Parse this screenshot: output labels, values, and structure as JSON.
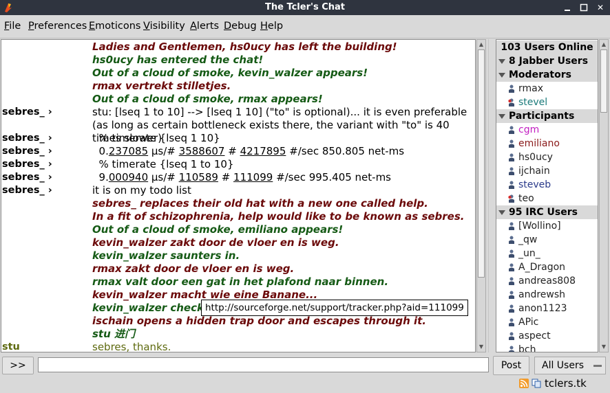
{
  "window": {
    "title": "The Tcler's Chat",
    "close_glyph": "✕"
  },
  "menu": [
    "File",
    "Preferences",
    "Emoticons",
    "Visibility",
    "Alerts",
    "Debug",
    "Help"
  ],
  "chat": {
    "rows": [
      {
        "nick": "",
        "parts": [
          {
            "t": "Ladies and Gentlemen, hs0ucy has left the building!"
          }
        ],
        "cls": "action red"
      },
      {
        "nick": "",
        "parts": [
          {
            "t": "hs0ucy has entered the chat!"
          }
        ],
        "cls": "action green"
      },
      {
        "nick": "",
        "parts": [
          {
            "t": "Out of a cloud of smoke, kevin_walzer appears!"
          }
        ],
        "cls": "action green"
      },
      {
        "nick": "",
        "parts": [
          {
            "t": "rmax vertrekt stilletjes."
          }
        ],
        "cls": "action red"
      },
      {
        "nick": "",
        "parts": [
          {
            "t": "Out of a cloud of smoke, rmax appears!"
          }
        ],
        "cls": "action green"
      },
      {
        "nick": "sebres_ ›",
        "parts": [
          {
            "t": "stu: [lseq 1 to 10] --> [lseq 1 10] (\"to\" is optional)... it is even preferable (as long as certain bottleneck exists there, the variant with \"to\" is 40 times slower)"
          }
        ],
        "cls": "",
        "wrap": true
      },
      {
        "nick": "sebres_ ›",
        "parts": [
          {
            "t": "  % timerate {lseq 1 10}"
          }
        ],
        "cls": ""
      },
      {
        "nick": "sebres_ ›",
        "parts": [
          {
            "t": "  0."
          },
          {
            "t": "237085",
            "u": true
          },
          {
            "t": " µs/# "
          },
          {
            "t": "3588607",
            "u": true
          },
          {
            "t": " # "
          },
          {
            "t": "4217895",
            "u": true
          },
          {
            "t": " #/sec 850.805 net-ms"
          }
        ],
        "cls": ""
      },
      {
        "nick": "sebres_ ›",
        "parts": [
          {
            "t": "  % timerate {lseq 1 to 10}"
          }
        ],
        "cls": ""
      },
      {
        "nick": "sebres_ ›",
        "parts": [
          {
            "t": "  9."
          },
          {
            "t": "000940",
            "u": true
          },
          {
            "t": " µs/# "
          },
          {
            "t": "110589",
            "u": true
          },
          {
            "t": " # "
          },
          {
            "t": "111099",
            "u": true
          },
          {
            "t": " #/sec 995.405 net-ms"
          }
        ],
        "cls": ""
      },
      {
        "nick": "sebres_ ›",
        "parts": [
          {
            "t": "it is on my todo list"
          }
        ],
        "cls": ""
      },
      {
        "nick": "",
        "parts": [
          {
            "t": "sebres_ replaces their old hat with a new one called help."
          }
        ],
        "cls": "action red"
      },
      {
        "nick": "",
        "parts": [
          {
            "t": "In a fit of schizophrenia, help would like to be known as sebres."
          }
        ],
        "cls": "action red"
      },
      {
        "nick": "",
        "parts": [
          {
            "t": "Out of a cloud of smoke, emiliano appears!"
          }
        ],
        "cls": "action green"
      },
      {
        "nick": "",
        "parts": [
          {
            "t": "kevin_walzer zakt door de vloer en is weg."
          }
        ],
        "cls": "action red"
      },
      {
        "nick": "",
        "parts": [
          {
            "t": "kevin_walzer saunters in."
          }
        ],
        "cls": "action green"
      },
      {
        "nick": "",
        "parts": [
          {
            "t": "rmax zakt door de vloer en is weg."
          }
        ],
        "cls": "action red"
      },
      {
        "nick": "",
        "parts": [
          {
            "t": "rmax valt door een gat in het plafond naar binnen."
          }
        ],
        "cls": "action green"
      },
      {
        "nick": "",
        "parts": [
          {
            "t": "kevin_walzer macht wie eine Banane..."
          }
        ],
        "cls": "action red"
      },
      {
        "nick": "",
        "parts": [
          {
            "t": "kevin_walzer checks"
          }
        ],
        "cls": "action green"
      },
      {
        "nick": "",
        "parts": [
          {
            "t": "ischain opens a hidden trap door and escapes through it."
          }
        ],
        "cls": "action red"
      },
      {
        "nick": "",
        "parts": [
          {
            "t": "stu 进门"
          }
        ],
        "cls": "action green"
      },
      {
        "nick": "stu",
        "parts": [
          {
            "t": "sebres, thanks."
          }
        ],
        "cls": "olive",
        "nick_cls": "olive"
      }
    ],
    "tooltip": "http://sourceforge.net/support/tracker.php?aid=111099"
  },
  "users": {
    "online": "103 Users Online",
    "groups": [
      {
        "label": "8 Jabber Users",
        "type": "group"
      },
      {
        "label": "Moderators",
        "type": "group"
      },
      {
        "name": "rmax",
        "color": "#222222",
        "icon": "person"
      },
      {
        "name": "stevel",
        "color": "#1a7a7a",
        "icon": "person-away"
      },
      {
        "label": "Participants",
        "type": "group"
      },
      {
        "name": "cgm",
        "color": "#c21ec2",
        "icon": "person"
      },
      {
        "name": "emiliano",
        "color": "#8a1a1a",
        "icon": "person"
      },
      {
        "name": "hs0ucy",
        "color": "#222222",
        "icon": "person"
      },
      {
        "name": "ijchain",
        "color": "#222222",
        "icon": "person"
      },
      {
        "name": "steveb",
        "color": "#2a3a8a",
        "icon": "person"
      },
      {
        "name": "teo",
        "color": "#222222",
        "icon": "person-away"
      },
      {
        "label": "95 IRC Users",
        "type": "group"
      },
      {
        "name": "[Wollino]",
        "color": "#222222",
        "icon": "person"
      },
      {
        "name": "_qw",
        "color": "#222222",
        "icon": "person"
      },
      {
        "name": "_un_",
        "color": "#222222",
        "icon": "person"
      },
      {
        "name": "A_Dragon",
        "color": "#222222",
        "icon": "person"
      },
      {
        "name": "andreas808",
        "color": "#222222",
        "icon": "person"
      },
      {
        "name": "andrewsh",
        "color": "#222222",
        "icon": "person"
      },
      {
        "name": "anon1123",
        "color": "#222222",
        "icon": "person"
      },
      {
        "name": "APic",
        "color": "#222222",
        "icon": "person"
      },
      {
        "name": "aspect",
        "color": "#222222",
        "icon": "person"
      },
      {
        "name": "bch",
        "color": "#222222",
        "icon": "person"
      }
    ]
  },
  "input": {
    "history_button": ">>",
    "post_button": "Post",
    "target_select": "All Users",
    "value": ""
  },
  "status": {
    "site": "tclers.tk"
  }
}
